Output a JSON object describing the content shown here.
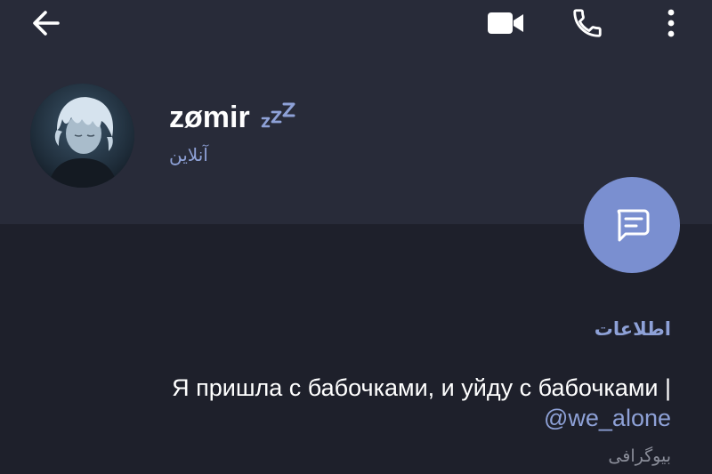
{
  "colors": {
    "header_bg": "#282b39",
    "body_bg": "#1e202b",
    "accent": "#8ea1d7",
    "fab": "#7a8fd0",
    "text_primary": "#ffffff",
    "text_secondary": "#8a8d99"
  },
  "topbar": {
    "back_icon": "arrow-left-icon",
    "video_icon": "video-camera-icon",
    "call_icon": "phone-icon",
    "more_icon": "more-vertical-icon"
  },
  "profile": {
    "name": "zømir",
    "status": "آنلاین",
    "sleep_icon": "zzz-icon",
    "avatar": "avatar"
  },
  "fab": {
    "icon": "message-icon"
  },
  "info": {
    "section_title": "اطلاعات",
    "bio": "Я пришла с бабочками, и уйду с бабочками |",
    "bio_link": "@we_alone",
    "bio_caption": "بیوگرافی"
  }
}
